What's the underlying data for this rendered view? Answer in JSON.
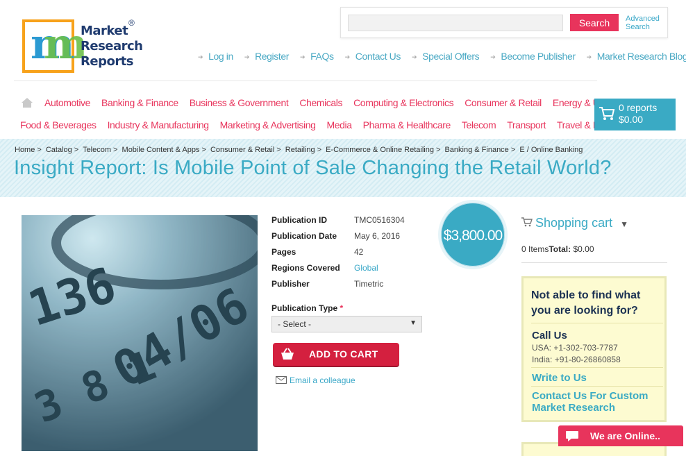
{
  "logo": {
    "letter": "m",
    "line1": "Market",
    "line2": "Research",
    "line3": "Reports",
    "registered": "®"
  },
  "search": {
    "placeholder": "",
    "button": "Search",
    "advanced_line1": "Advanced",
    "advanced_line2": "Search"
  },
  "top_links": [
    "Log in",
    "Register",
    "FAQs",
    "Contact Us",
    "Special Offers",
    "Become Publisher",
    "Market Research Blog"
  ],
  "categories_row1": [
    "Automotive",
    "Banking & Finance",
    "Business & Government",
    "Chemicals",
    "Computing & Electronics",
    "Consumer & Retail",
    "Energy & Utilities"
  ],
  "categories_row2": [
    "Food & Beverages",
    "Industry & Manufacturing",
    "Marketing & Advertising",
    "Media",
    "Pharma & Healthcare",
    "Telecom",
    "Transport",
    "Travel & Leisure"
  ],
  "cart_box": {
    "count": "0 reports",
    "total": "$0.00"
  },
  "breadcrumb": [
    "Home",
    "Catalog",
    "Telecom",
    "Mobile Content & Apps",
    "Consumer & Retail",
    "Retailing",
    "E-Commerce & Online Retailing",
    "Banking & Finance",
    "E / Online Banking"
  ],
  "title": "Insight Report: Is Mobile Point of Sale Changing the Retail World?",
  "details": {
    "publication_id_label": "Publication ID",
    "publication_id": "TMC0516304",
    "publication_date_label": "Publication Date",
    "publication_date": "May 6, 2016",
    "pages_label": "Pages",
    "pages": "42",
    "regions_label": "Regions Covered",
    "regions": "Global",
    "publisher_label": "Publisher",
    "publisher": "Timetric"
  },
  "publication_type": {
    "label": "Publication Type",
    "required": "*",
    "selected": "- Select -"
  },
  "add_to_cart": "ADD TO CART",
  "email_colleague": "Email a colleague",
  "price": "$3,800.00",
  "shopping_cart": {
    "title": "Shopping cart",
    "items": "0 Items",
    "total_label": "Total:",
    "total": "$0.00"
  },
  "help": {
    "question": "Not able to find what you are looking for?",
    "call_us": "Call Us",
    "usa": "USA: +1-302-703-7787",
    "india": "India: +91-80-26860858",
    "write": "Write to Us",
    "custom": "Contact Us For Custom Market Research"
  },
  "chat": "We are Online..",
  "colors": {
    "accent": "#3aaac4",
    "brand_red": "#e8345c",
    "cart_red": "#d4203f"
  }
}
